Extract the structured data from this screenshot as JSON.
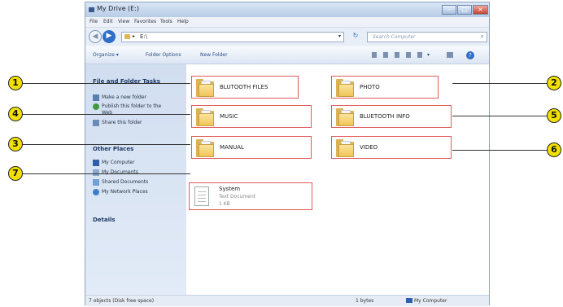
{
  "window": {
    "title": "My Drive (E:)",
    "controls": [
      "–",
      "□",
      "×"
    ]
  },
  "menu": [
    "File",
    "Edit",
    "View",
    "Favorites",
    "Tools",
    "Help"
  ],
  "address": {
    "path": "E:\\",
    "search_placeholder": "Search Computer"
  },
  "toolbar": {
    "organize": "Organize ▾",
    "folder_options": "Folder Options",
    "new_folder": "New Folder"
  },
  "tasks": {
    "file_folder_header": "File and Folder Tasks",
    "file_folder_items": [
      "Make a new folder",
      "Publish this folder to the",
      "Web",
      "Share this folder"
    ],
    "other_places_header": "Other Places",
    "other_places_items": [
      "My Computer",
      "My Documents",
      "Shared Documents",
      "My Network Places"
    ],
    "details_header": "Details"
  },
  "folders": [
    {
      "name": "BLUTOOTH FILES",
      "callout": "1"
    },
    {
      "name": "PHOTO",
      "callout": "2"
    },
    {
      "name": "MUSIC",
      "callout": "4"
    },
    {
      "name": "BLUETOOTH INFO",
      "callout": "5"
    },
    {
      "name": "MANUAL",
      "callout": "3"
    },
    {
      "name": "VIDEO",
      "callout": "6"
    }
  ],
  "file": {
    "name": "System",
    "type": "Text Document",
    "size": "1 KB",
    "callout": "7"
  },
  "statusbar": {
    "left": "7 objects (Disk free space)",
    "mid": "1 bytes",
    "right": "My Computer"
  },
  "colors": {
    "highlight": "#e05a5a",
    "callout_fill": "#f2e000",
    "taskpane": "#d1def0"
  }
}
